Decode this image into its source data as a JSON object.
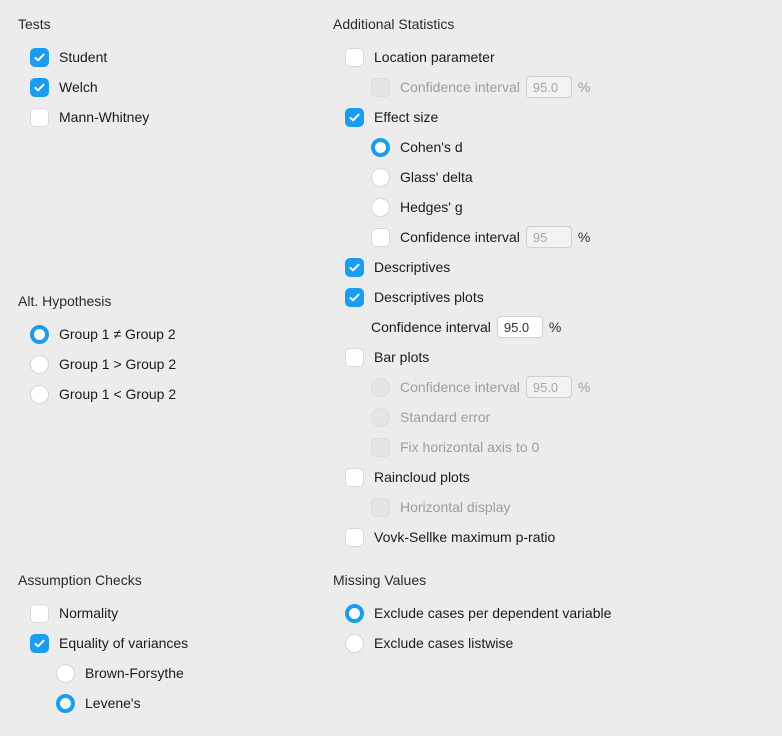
{
  "tests": {
    "title": "Tests",
    "student": "Student",
    "welch": "Welch",
    "mann_whitney": "Mann-Whitney"
  },
  "alt": {
    "title": "Alt. Hypothesis",
    "neq": "Group 1 ≠ Group 2",
    "gt": "Group 1 > Group 2",
    "lt": "Group 1 < Group 2"
  },
  "assump": {
    "title": "Assumption Checks",
    "normality": "Normality",
    "eqvar": "Equality of variances",
    "brown": "Brown-Forsythe",
    "levene": "Levene's"
  },
  "addl": {
    "title": "Additional Statistics",
    "location": "Location parameter",
    "loc_ci": "Confidence interval",
    "loc_ci_val": "95.0",
    "effect": "Effect size",
    "cohen": "Cohen's d",
    "glass": "Glass' delta",
    "hedges": "Hedges' g",
    "eff_ci": "Confidence interval",
    "eff_ci_val": "95",
    "desc": "Descriptives",
    "desc_plots": "Descriptives plots",
    "dp_ci": "Confidence interval",
    "dp_ci_val": "95.0",
    "bar": "Bar plots",
    "bar_ci": "Confidence interval",
    "bar_ci_val": "95.0",
    "bar_se": "Standard error",
    "bar_fix": "Fix horizontal axis to 0",
    "rain": "Raincloud plots",
    "rain_h": "Horizontal display",
    "vovk": "Vovk-Sellke maximum p-ratio",
    "pct": "%"
  },
  "missing": {
    "title": "Missing Values",
    "per_dep": "Exclude cases per dependent variable",
    "listwise": "Exclude cases listwise"
  }
}
